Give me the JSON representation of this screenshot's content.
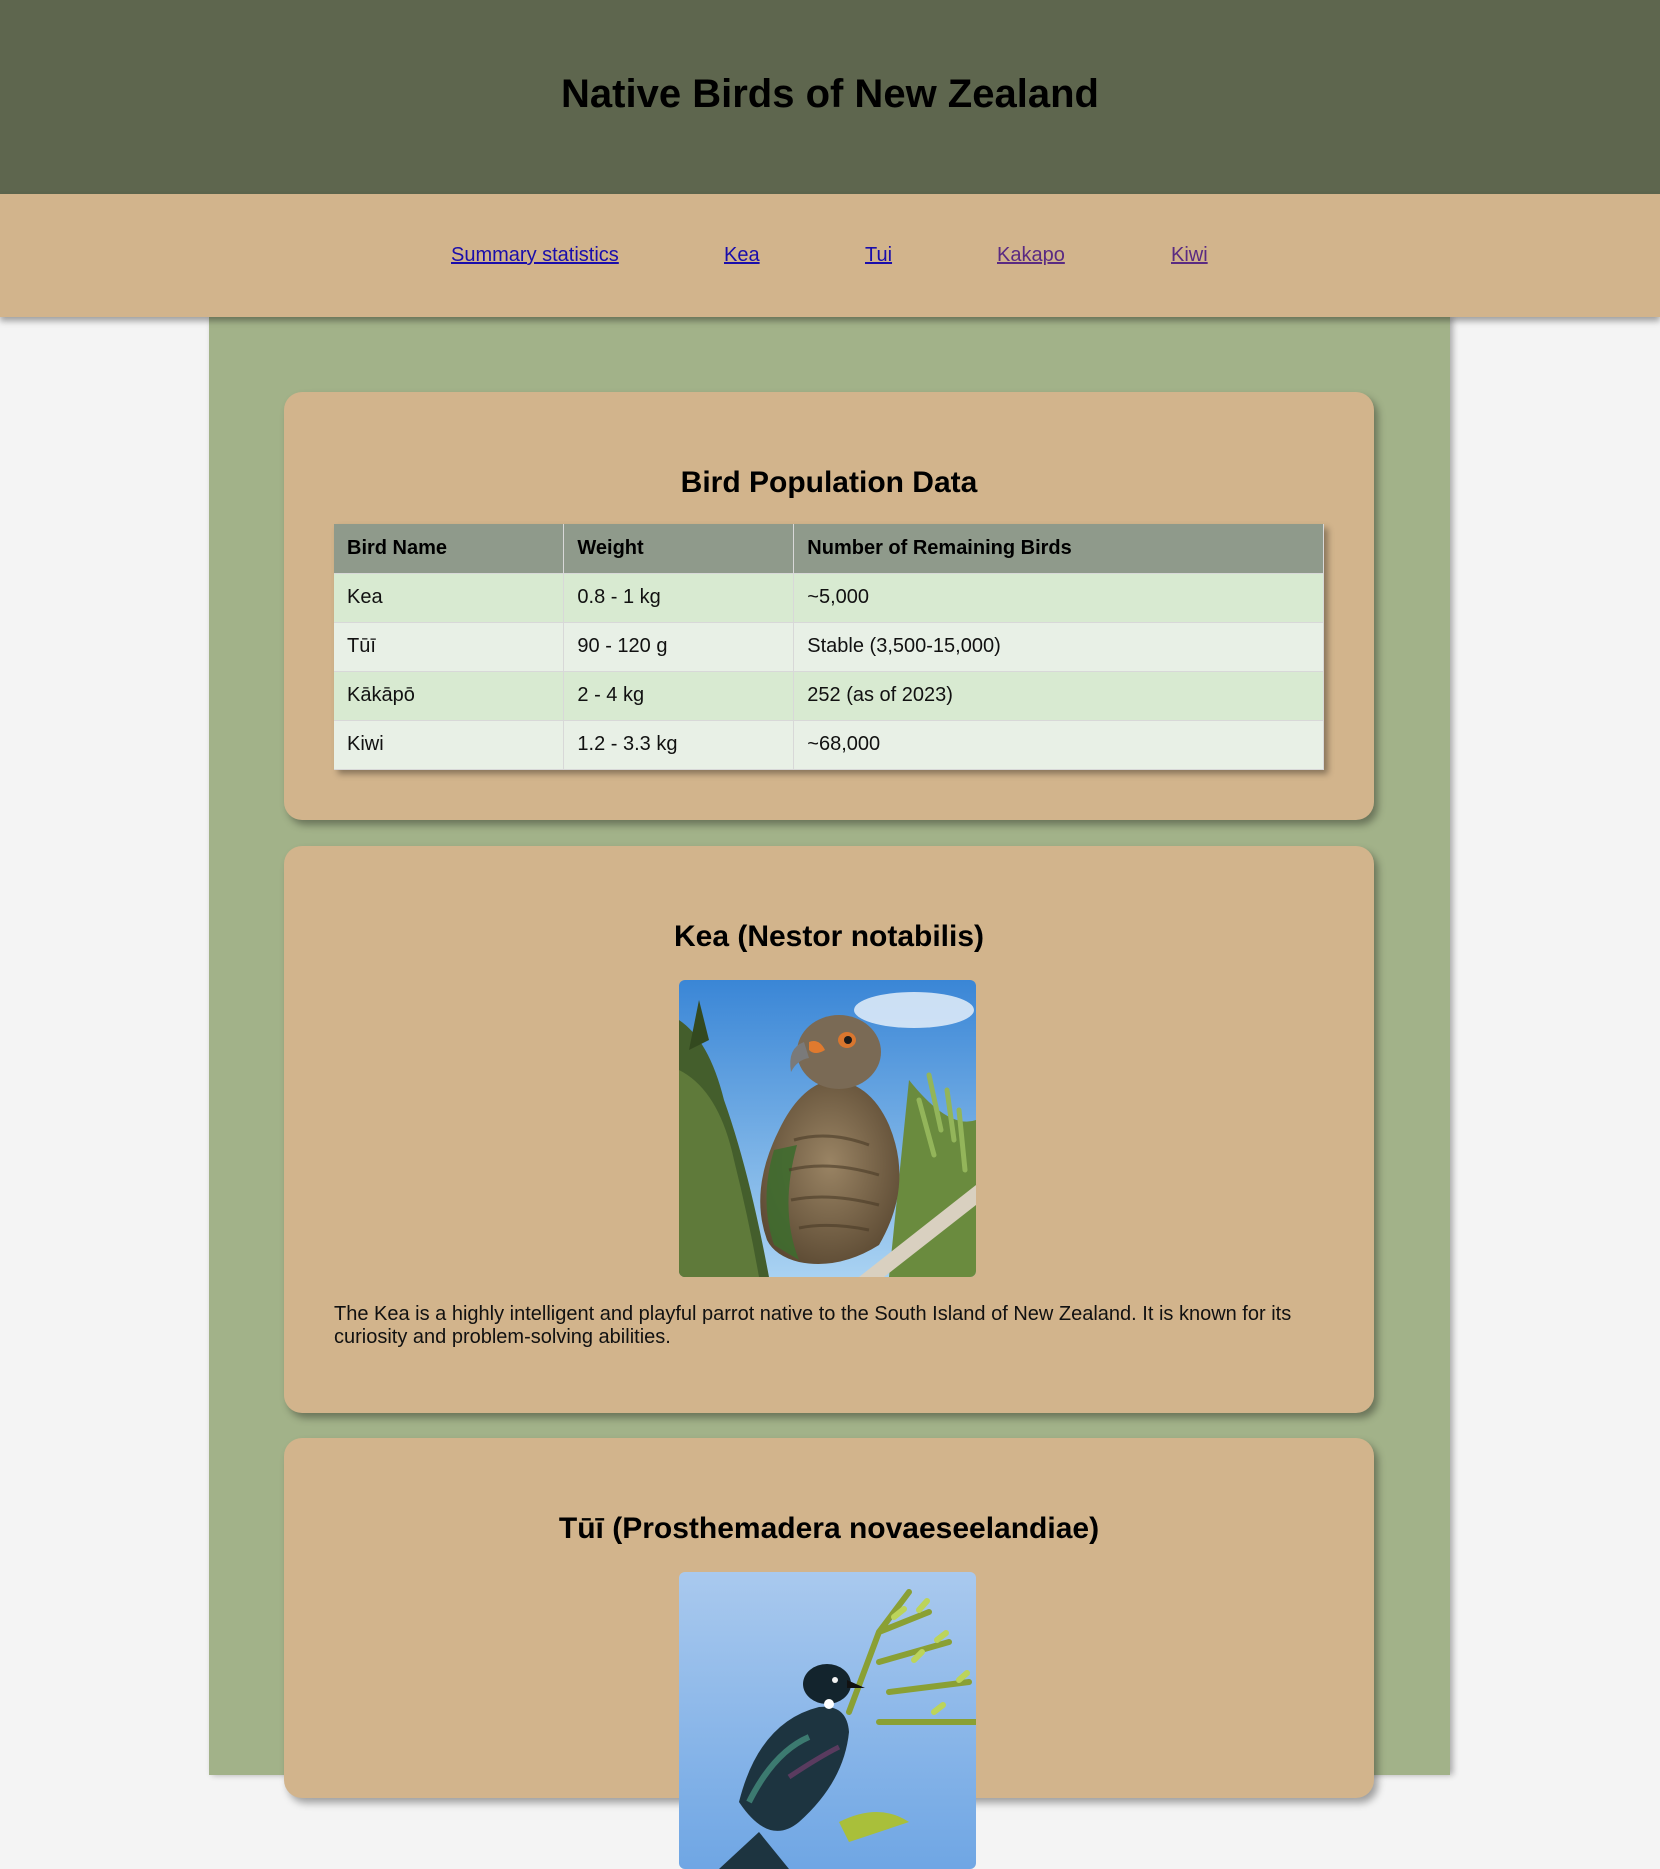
{
  "header": {
    "title": "Native Birds of New Zealand"
  },
  "nav": {
    "links": [
      {
        "label": "Summary statistics "
      },
      {
        "label": "Kea "
      },
      {
        "label": "Tui "
      },
      {
        "label": "Kakapo "
      },
      {
        "label": "Kiwi"
      }
    ]
  },
  "summary": {
    "title": "Bird Population Data",
    "columns": [
      "Bird Name",
      "Weight",
      "Number of Remaining Birds"
    ],
    "rows": [
      [
        "Kea",
        "0.8 - 1 kg",
        "~5,000"
      ],
      [
        "Tūī",
        "90 - 120 g",
        "Stable (3,500-15,000)"
      ],
      [
        "Kākāpō",
        "2 - 4 kg",
        "252 (as of 2023)"
      ],
      [
        "Kiwi",
        "1.2 - 3.3 kg",
        "~68,000"
      ]
    ]
  },
  "kea": {
    "title": "Kea (Nestor notabilis)",
    "description": "The Kea is a highly intelligent and playful parrot native to the South Island of New Zealand. It is known for its curiosity and problem-solving abilities."
  },
  "tui": {
    "title": "Tūī (Prosthemadera novaeseelandiae)"
  }
}
